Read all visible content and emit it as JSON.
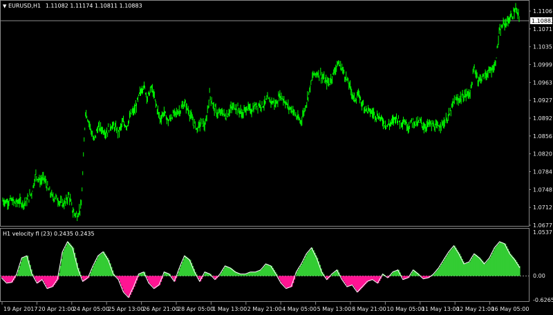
{
  "main_chart": {
    "symbol_title": "EURUSD,H1",
    "ohlc_text": "1.11082 1.11174 1.10811 1.10883",
    "current_price": "1.10883",
    "price_labels": [
      "1.11061",
      "1.10711",
      "1.10351",
      "1.09991",
      "1.09631",
      "1.09271",
      "1.08921",
      "1.08561",
      "1.08201",
      "1.07841",
      "1.07481",
      "1.07121",
      "1.06771"
    ],
    "price_range": [
      1.0668,
      1.1121
    ],
    "candle_color": "#00ff00",
    "price_series": [
      1.0718,
      1.0716,
      1.0719,
      1.0713,
      1.0717,
      1.0712,
      1.0721,
      1.0735,
      1.0772,
      1.0758,
      1.0765,
      1.0741,
      1.0726,
      1.0724,
      1.0713,
      1.0712,
      1.073,
      1.0695,
      1.0688,
      1.0708,
      1.0902,
      1.0875,
      1.084,
      1.0868,
      1.0865,
      1.0857,
      1.0872,
      1.087,
      1.0858,
      1.0878,
      1.0872,
      1.0895,
      1.0905,
      1.0935,
      1.0955,
      1.093,
      1.095,
      1.0918,
      1.0885,
      1.09,
      1.088,
      1.0893,
      1.0898,
      1.0905,
      1.0918,
      1.09,
      1.088,
      1.0865,
      1.088,
      1.087,
      1.0935,
      1.091,
      1.0895,
      1.09,
      1.089,
      1.0905,
      1.0912,
      1.0905,
      1.0895,
      1.091,
      1.0902,
      1.0912,
      1.0915,
      1.0915,
      1.0925,
      1.0922,
      1.0915,
      1.0935,
      1.0925,
      1.091,
      1.0905,
      1.089,
      1.088,
      1.0905,
      1.094,
      1.0975,
      1.098,
      1.0975,
      1.0962,
      1.096,
      1.098,
      1.1,
      1.099,
      1.097,
      1.095,
      1.0925,
      1.0935,
      1.0915,
      1.0905,
      1.09,
      1.0895,
      1.089,
      1.088,
      1.0872,
      1.0878,
      1.089,
      1.088,
      1.0882,
      1.087,
      1.0882,
      1.0875,
      1.088,
      1.0868,
      1.0876,
      1.0872,
      1.0868,
      1.0875,
      1.088,
      1.0895,
      1.092,
      1.0925,
      1.093,
      1.0935,
      1.094,
      1.099,
      1.0965,
      1.0972,
      1.0978,
      1.0985,
      1.0995,
      1.106,
      1.108,
      1.1085,
      1.1095,
      1.111,
      1.1088
    ]
  },
  "indicator": {
    "title": "H1 velocity fl (23) 0.2435 0.2435",
    "labels": {
      "top": "1.0537",
      "zero": "0.00",
      "bottom": "-0.6265"
    },
    "range": [
      -0.6265,
      1.0537
    ],
    "pos_color": "#33cc33",
    "neg_color": "#ff1493",
    "values": [
      -0.05,
      -0.2,
      -0.18,
      0.05,
      0.45,
      0.5,
      0.05,
      -0.2,
      -0.1,
      -0.35,
      -0.3,
      -0.1,
      0.6,
      0.85,
      0.7,
      0.2,
      -0.15,
      -0.05,
      0.25,
      0.5,
      0.6,
      0.4,
      0.05,
      -0.1,
      -0.45,
      -0.6,
      -0.3,
      0.05,
      0.1,
      -0.2,
      -0.35,
      -0.25,
      0.1,
      0.05,
      -0.15,
      0.2,
      0.5,
      0.4,
      0.1,
      -0.15,
      0.1,
      0.05,
      -0.1,
      0.05,
      0.25,
      0.2,
      0.1,
      0.05,
      0.05,
      0.1,
      0.1,
      0.15,
      0.3,
      0.25,
      0.05,
      -0.2,
      -0.35,
      -0.3,
      0.1,
      0.3,
      0.55,
      0.7,
      0.45,
      0.1,
      -0.1,
      0.05,
      0.15,
      -0.1,
      -0.3,
      -0.25,
      -0.45,
      -0.3,
      -0.15,
      -0.1,
      -0.2,
      0.05,
      -0.05,
      0.1,
      0.15,
      -0.1,
      -0.05,
      0.15,
      0.05,
      -0.08,
      -0.05,
      0.05,
      0.2,
      0.4,
      0.6,
      0.75,
      0.55,
      0.3,
      0.35,
      0.55,
      0.45,
      0.3,
      0.45,
      0.7,
      0.85,
      0.8,
      0.55,
      0.4,
      0.2
    ]
  },
  "time_axis": {
    "labels": [
      "19 Apr 2017",
      "20 Apr 21:00",
      "24 Apr 05:00",
      "25 Apr 13:00",
      "26 Apr 21:00",
      "28 Apr 05:00",
      "1 May 13:00",
      "2 May 21:00",
      "4 May 05:00",
      "5 May 13:00",
      "8 May 21:00",
      "10 May 05:00",
      "11 May 13:00",
      "12 May 21:00",
      "16 May 05:00"
    ]
  }
}
